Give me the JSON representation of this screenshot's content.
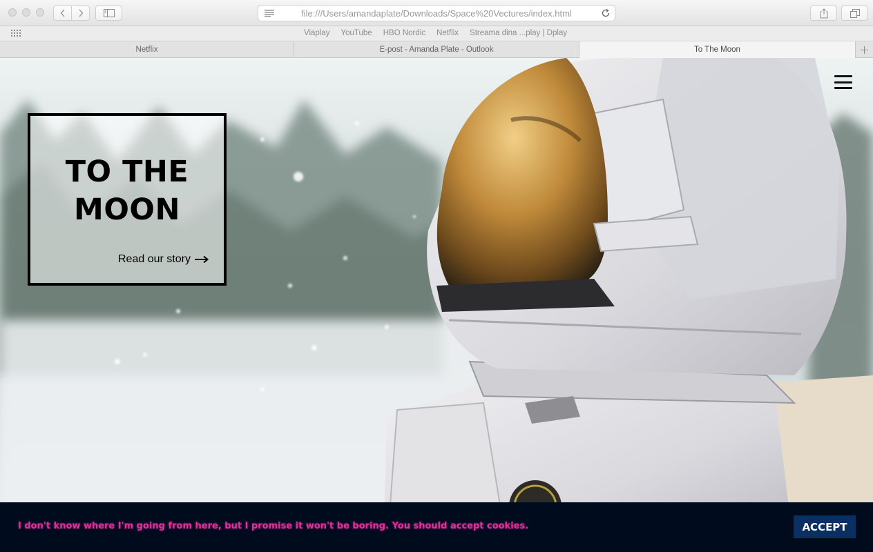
{
  "browser": {
    "address_url": "file:///Users/amandaplate/Downloads/Space%20Vectures/index.html",
    "bookmarks": [
      "Viaplay",
      "YouTube",
      "HBO Nordic",
      "Netflix",
      "Streama dina ...play | Dplay"
    ],
    "tabs": [
      {
        "label": "Netflix",
        "active": false
      },
      {
        "label": "E-post - Amanda Plate - Outlook",
        "active": false
      },
      {
        "label": "To The Moon",
        "active": true
      }
    ]
  },
  "hero": {
    "title_line1": "TO THE",
    "title_line2": "MOON",
    "cta_label": "Read our story",
    "arrow": "⟶"
  },
  "cookie": {
    "message": "I don't know where I'm going from here, but I promise it won't be boring. You should accept cookies.",
    "accept_label": "ACCEPT"
  },
  "colors": {
    "cookie_bg": "#010b1e",
    "cookie_text": "#e0309a",
    "accept_bg": "#0c2f63"
  }
}
